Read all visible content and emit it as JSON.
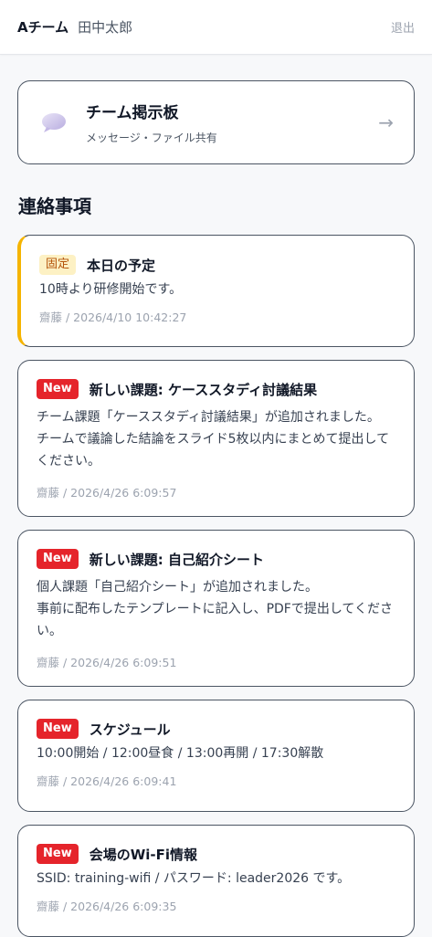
{
  "header": {
    "team": "Aチーム",
    "user": "田中太郎",
    "logout": "退出"
  },
  "board": {
    "title": "チーム掲示板",
    "subtitle": "メッセージ・ファイル共有",
    "icon": "chat-bubble-icon",
    "arrow": "→"
  },
  "section_title": "連絡事項",
  "notices": [
    {
      "badge": "固定",
      "title": "本日の予定",
      "body": "10時より研修開始です。",
      "meta": "齋藤 / 2026/4/10 10:42:27"
    },
    {
      "badge": "New",
      "title": "新しい課題: ケーススタディ討議結果",
      "body": "チーム課題「ケーススタディ討議結果」が追加されました。\nチームで議論した結論をスライド5枚以内にまとめて提出してください。",
      "meta": "齋藤 / 2026/4/26 6:09:57"
    },
    {
      "badge": "New",
      "title": "新しい課題: 自己紹介シート",
      "body": "個人課題「自己紹介シート」が追加されました。\n事前に配布したテンプレートに記入し、PDFで提出してください。",
      "meta": "齋藤 / 2026/4/26 6:09:51"
    },
    {
      "badge": "New",
      "title": "スケジュール",
      "body": "10:00開始 / 12:00昼食 / 13:00再開 / 17:30解散",
      "meta": "齋藤 / 2026/4/26 6:09:41"
    },
    {
      "badge": "New",
      "title": "会場のWi-Fi情報",
      "body": "SSID: training-wifi / パスワード: leader2026 です。",
      "meta": "齋藤 / 2026/4/26 6:09:35"
    }
  ],
  "colors": {
    "pin_accent": "#f5b400",
    "new_badge": "#e5242b",
    "pin_badge_bg": "#fdf1c4"
  }
}
